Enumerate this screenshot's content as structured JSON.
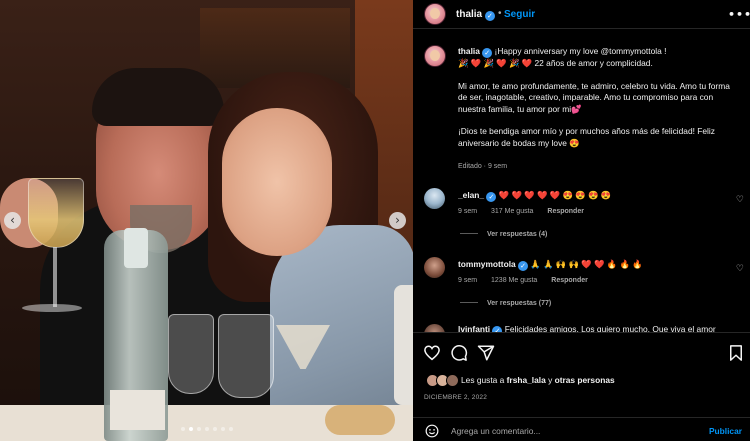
{
  "post": {
    "username": "thalia",
    "separator": "•",
    "follow_label": "Seguir",
    "more_label": "•••",
    "caption": {
      "username": "thalia",
      "line1": "¡Happy anniversary my love @tommymottola !",
      "line2": "🎉 ❤️ 🎉 ❤️ 🎉 ❤️  22 años de amor y complicidad.",
      "para2": "Mi amor, te amo profundamente, te admiro, celebro tu vida. Amo tu forma de ser, inagotable, creativo, imparable. Amo tu compromiso para con nuestra familia, tu amor por mi💕",
      "para3": "¡Dios te bendiga amor mío y por muchos años más de felicidad! Feliz aniversario de bodas my love 😍",
      "meta": "Editado · 9 sem"
    },
    "comments": [
      {
        "username": "_elan_",
        "text": "❤️ ❤️ ❤️ ❤️ ❤️ 😍 😍 😍 😍",
        "time": "9 sem",
        "likes": "317 Me gusta",
        "reply_label": "Responder",
        "replies_label": "Ver respuestas (4)"
      },
      {
        "username": "tommymottola",
        "text": "🙏 🙏 🙌 🙌 ❤️ ❤️ 🔥 🔥 🔥",
        "time": "9 sem",
        "likes": "1238 Me gusta",
        "reply_label": "Responder",
        "replies_label": "Ver respuestas (77)"
      },
      {
        "username": "lvinfanti",
        "text": "Felicidades amigos. Los quiero mucho. Que viva el amor"
      }
    ],
    "likes_prefix": "Les gusta a",
    "likes_user": "frsha_lala",
    "likes_join": "y",
    "likes_others": "otras personas",
    "date": "DICIEMBRE 2, 2022",
    "comment_placeholder": "Agrega un comentario...",
    "publish_label": "Publicar"
  },
  "colors": {
    "accent": "#0095f6",
    "verified": "#3897f0",
    "background": "#000000",
    "muted": "#a8a8a8"
  },
  "icons": [
    "heart-icon",
    "comment-icon",
    "share-icon",
    "bookmark-icon",
    "emoji-icon",
    "verified-icon",
    "chevron-left-icon",
    "chevron-right-icon"
  ],
  "carousel": {
    "slides": 7,
    "active_index": 1
  }
}
